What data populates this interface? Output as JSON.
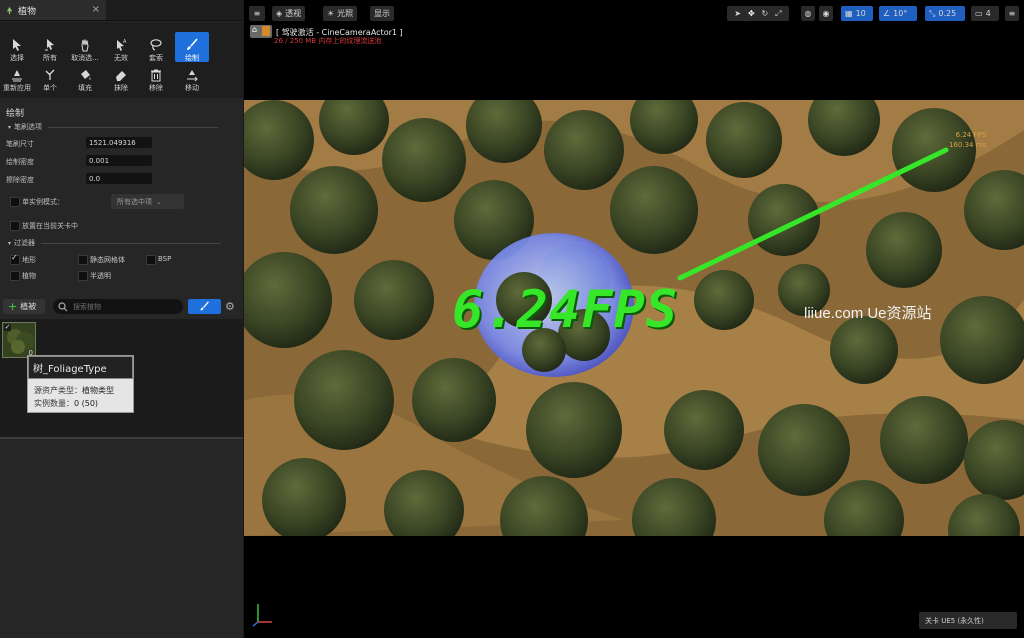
{
  "panel": {
    "tab_label": "植物",
    "tools": [
      {
        "label": "选择",
        "icon": "select-arrow-icon"
      },
      {
        "label": "所有",
        "icon": "select-all-icon"
      },
      {
        "label": "取消选...",
        "icon": "deselect-hand-icon"
      },
      {
        "label": "无效",
        "icon": "invalid-select-icon"
      },
      {
        "label": "套索",
        "icon": "lasso-icon"
      },
      {
        "label": "绘制",
        "icon": "paint-brush-icon"
      },
      {
        "label": "重新应用",
        "icon": "reapply-icon"
      },
      {
        "label": "单个",
        "icon": "single-plant-icon"
      },
      {
        "label": "填充",
        "icon": "fill-bucket-icon"
      },
      {
        "label": "抹除",
        "icon": "eraser-icon"
      },
      {
        "label": "移除",
        "icon": "trash-icon"
      },
      {
        "label": "移动",
        "icon": "move-icon"
      }
    ],
    "section_title": "绘制",
    "brush_group": "笔刷选项",
    "brush_size_label": "笔刷尺寸",
    "brush_size_value": "1521.049316",
    "paint_density_label": "绘制密度",
    "paint_density_value": "0.001",
    "erase_density_label": "擦除密度",
    "erase_density_value": "0.0",
    "single_instance_label": "单实例模式：",
    "single_instance_dropdown": "所有选中项",
    "current_level_label": "放置在当前关卡中",
    "filter_group": "过滤器",
    "filters": [
      {
        "label": "地形",
        "checked": true
      },
      {
        "label": "静态网格体",
        "checked": false
      },
      {
        "label": "BSP",
        "checked": false
      },
      {
        "label": "植物",
        "checked": false
      },
      {
        "label": "半透明",
        "checked": false
      }
    ],
    "add_button": "植被",
    "search_placeholder": "搜索植物",
    "foliage_count": "0",
    "tooltip": {
      "title": "树_FoliageType",
      "source_type_label": "源资产类型：",
      "source_type_value": "植物类型",
      "instance_count_label": "实例数量：",
      "instance_count_value": "0 (50)"
    }
  },
  "viewport": {
    "perspective_label": "透视",
    "lighting_label": "光照",
    "show_label": "显示",
    "grid_snap_value": "10",
    "rotation_snap_value": "10°",
    "scale_snap_value": "0.25",
    "camera_speed_value": "4",
    "pilot_label": "[ 驾驶激活 - CineCameraActor1 ]",
    "warning_label": "26 / 250 MB 内存上的纹理流送池",
    "fps_small": "6.24 FPS",
    "ms_small": "160.34 ms",
    "fps_big": "6.24FPS",
    "watermark": "liiue.com  Ue资源站",
    "level_badge": "关卡  UE5 (永久性)",
    "colors": {
      "fps_big": "#36e629",
      "accent": "#1f6fdc",
      "ground": "#a37b44"
    }
  }
}
